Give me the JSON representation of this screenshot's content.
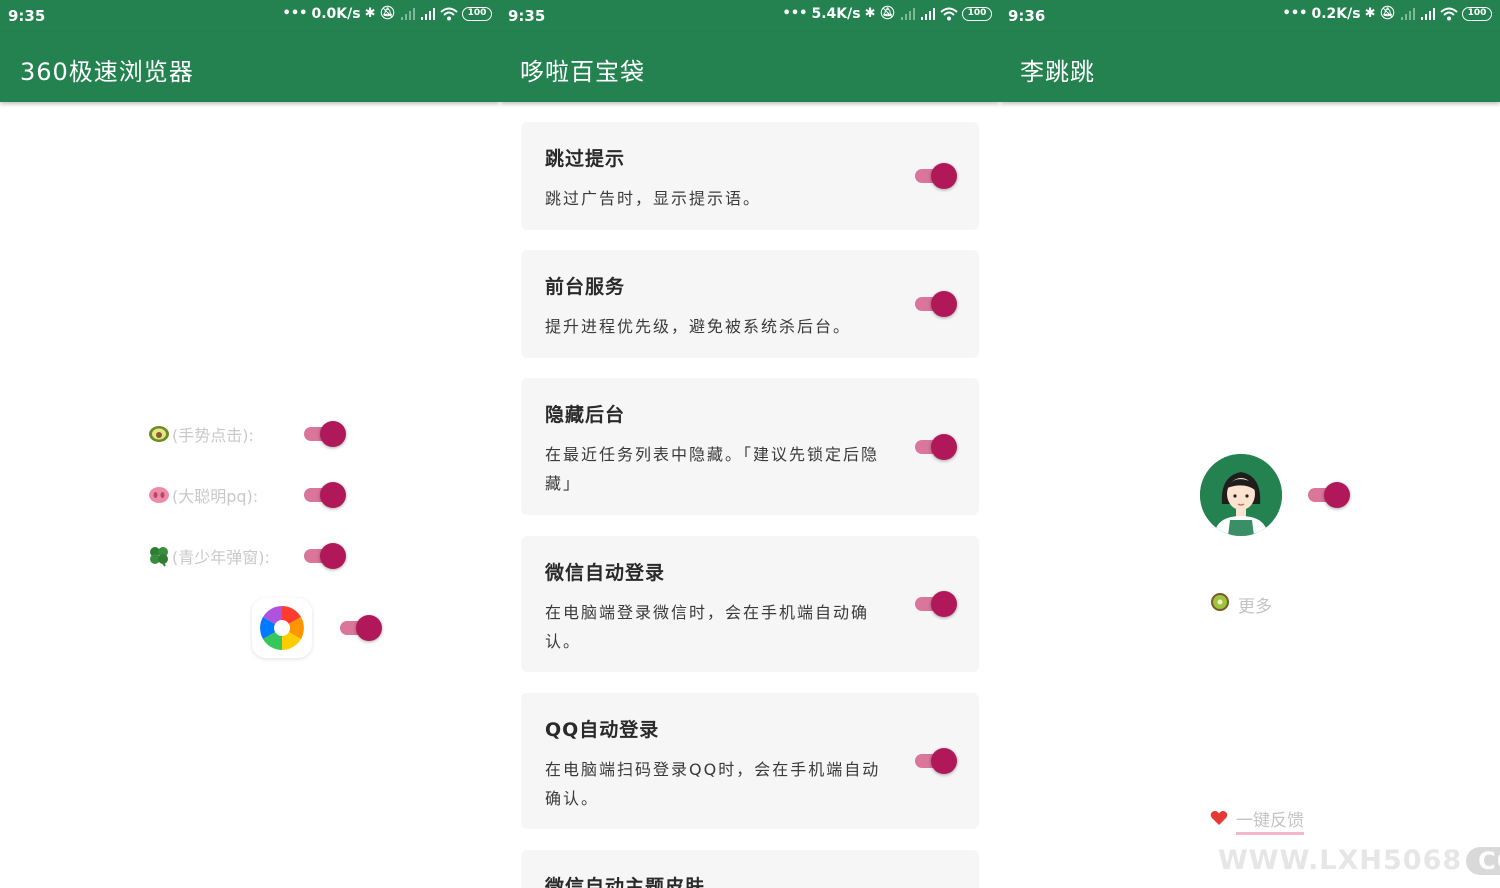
{
  "colors": {
    "primary": "#23824f",
    "toggle_thumb": "#b0185a",
    "toggle_track": "#d9769a",
    "card_bg": "#f6f6f6"
  },
  "screens": [
    {
      "status": {
        "time": "9:35",
        "speed": "0.0K/s",
        "battery": "100"
      },
      "title": "360极速浏览器",
      "rows": [
        {
          "icon": "avocado-icon",
          "label": "(手势点击):",
          "toggle_on": true
        },
        {
          "icon": "pig-nose-icon",
          "label": "(大聪明pq):",
          "toggle_on": true
        },
        {
          "icon": "clover-icon",
          "label": "(青少年弹窗):",
          "toggle_on": true
        }
      ],
      "app_icon": "pinwheel-app-icon"
    },
    {
      "status": {
        "time": "9:35",
        "speed": "5.4K/s",
        "battery": "100"
      },
      "title": "哆啦百宝袋",
      "cards": [
        {
          "title": "跳过提示",
          "desc": "跳过广告时，显示提示语。",
          "toggle_on": true
        },
        {
          "title": "前台服务",
          "desc": "提升进程优先级，避免被系统杀后台。",
          "toggle_on": true
        },
        {
          "title": "隐藏后台",
          "desc": "在最近任务列表中隐藏。「建议先锁定后隐藏」",
          "toggle_on": true
        },
        {
          "title": "微信自动登录",
          "desc": "在电脑端登录微信时，会在手机端自动确认。",
          "toggle_on": true
        },
        {
          "title": "QQ自动登录",
          "desc": "在电脑端扫码登录QQ时，会在手机端自动确认。",
          "toggle_on": true
        },
        {
          "title": "微信自动主题皮肤",
          "desc": "",
          "toggle_on": true
        }
      ]
    },
    {
      "status": {
        "time": "9:36",
        "speed": "0.2K/s",
        "battery": "100"
      },
      "title": "李跳跳",
      "more_label": "更多",
      "feedback_label": "一键反馈",
      "watermark": {
        "main": "WWW.LXH5068",
        "suffix": "COM"
      }
    }
  ]
}
